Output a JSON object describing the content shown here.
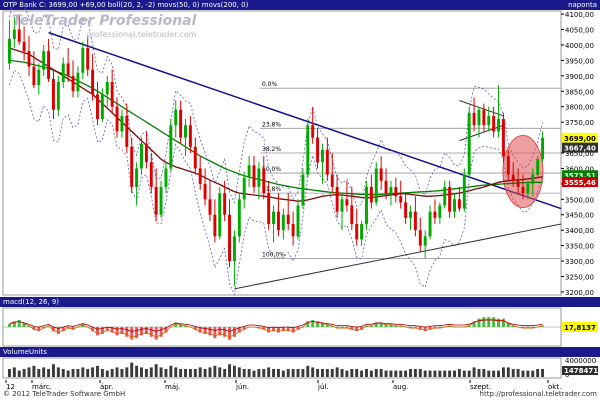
{
  "header": {
    "title": "OTP Bank",
    "info_text": "OTP Bank  C: 3699,00 +69,00  boll(20, 2, -2)  movs(50, 0)  movs(200, 0)",
    "period": "napontа",
    "watermark_line1": "TeleTrader Professional",
    "watermark_line2": "professional.teletrader.com"
  },
  "macd": {
    "label": "macd(12, 26, 9)",
    "value_label": "17,8137",
    "ticks": [
      "0"
    ]
  },
  "volume": {
    "label": "VolumeUnits",
    "ticks": [
      "4000000",
      "0"
    ],
    "value_label": "1478471"
  },
  "footer": {
    "copyright": "© 2012 TeleTrader Software GmbH",
    "url": "http://professional.teletrader.com"
  },
  "colors": {
    "up": "#00aa00",
    "down": "#dd0000",
    "trend": "#10108a",
    "sma50": "#7a0a0a",
    "sma200": "#008000",
    "boll": "#6060b0",
    "fib": "#999999",
    "highlight": "#e05050"
  },
  "chart_data": {
    "type": "candlestick",
    "title": "OTP Bank",
    "x_tick_labels": [
      "12",
      "márc.",
      "ápr.",
      "máj.",
      "jún.",
      "júl.",
      "aug.",
      "szept.",
      "okt."
    ],
    "y_tick_labels": [
      "4100,00",
      "4050,00",
      "4000,00",
      "3950,00",
      "3900,00",
      "3850,00",
      "3800,00",
      "3750,00",
      "3650,00",
      "3600,00",
      "3550,00",
      "3500,00",
      "3450,00",
      "3400,00",
      "3350,00",
      "3300,00",
      "3250,00",
      "3200,00"
    ],
    "y_ticks": [
      4100,
      4050,
      4000,
      3950,
      3900,
      3850,
      3800,
      3750,
      3650,
      3600,
      3550,
      3500,
      3450,
      3400,
      3350,
      3300,
      3250,
      3200
    ],
    "ylim": [
      3190,
      4110
    ],
    "last_price_label": "3699,00",
    "sma50_label": "3573,51",
    "sma200_label": "3555,46",
    "bb_label": "3667,40",
    "fib_levels": [
      {
        "label": "0,0%",
        "value": 3860
      },
      {
        "label": "23,8%",
        "value": 3730
      },
      {
        "label": "38,2%",
        "value": 3650
      },
      {
        "label": "50,0%",
        "value": 3585
      },
      {
        "label": "61,8%",
        "value": 3520
      },
      {
        "label": "100,0%",
        "value": 3308
      }
    ],
    "candles": [
      {
        "o": 3940,
        "h": 4080,
        "l": 3920,
        "c": 4020
      },
      {
        "o": 4020,
        "h": 4090,
        "l": 3990,
        "c": 4050
      },
      {
        "o": 4050,
        "h": 4100,
        "l": 4000,
        "c": 4010
      },
      {
        "o": 4010,
        "h": 4060,
        "l": 3950,
        "c": 3980
      },
      {
        "o": 3980,
        "h": 4030,
        "l": 3900,
        "c": 3930
      },
      {
        "o": 3930,
        "h": 3980,
        "l": 3860,
        "c": 3870
      },
      {
        "o": 3870,
        "h": 3940,
        "l": 3840,
        "c": 3920
      },
      {
        "o": 3920,
        "h": 4000,
        "l": 3900,
        "c": 3980
      },
      {
        "o": 3980,
        "h": 4020,
        "l": 3880,
        "c": 3890
      },
      {
        "o": 3890,
        "h": 3920,
        "l": 3760,
        "c": 3790
      },
      {
        "o": 3790,
        "h": 3900,
        "l": 3770,
        "c": 3880
      },
      {
        "o": 3880,
        "h": 3960,
        "l": 3860,
        "c": 3940
      },
      {
        "o": 3940,
        "h": 3990,
        "l": 3880,
        "c": 3900
      },
      {
        "o": 3900,
        "h": 3950,
        "l": 3830,
        "c": 3850
      },
      {
        "o": 3850,
        "h": 3930,
        "l": 3830,
        "c": 3910
      },
      {
        "o": 3910,
        "h": 4010,
        "l": 3890,
        "c": 3990
      },
      {
        "o": 3990,
        "h": 4030,
        "l": 3900,
        "c": 3920
      },
      {
        "o": 3920,
        "h": 3970,
        "l": 3820,
        "c": 3840
      },
      {
        "o": 3840,
        "h": 3880,
        "l": 3740,
        "c": 3760
      },
      {
        "o": 3760,
        "h": 3860,
        "l": 3750,
        "c": 3840
      },
      {
        "o": 3840,
        "h": 3900,
        "l": 3800,
        "c": 3880
      },
      {
        "o": 3880,
        "h": 3920,
        "l": 3780,
        "c": 3800
      },
      {
        "o": 3800,
        "h": 3830,
        "l": 3700,
        "c": 3720
      },
      {
        "o": 3720,
        "h": 3790,
        "l": 3700,
        "c": 3770
      },
      {
        "o": 3770,
        "h": 3810,
        "l": 3650,
        "c": 3670
      },
      {
        "o": 3670,
        "h": 3700,
        "l": 3520,
        "c": 3540
      },
      {
        "o": 3540,
        "h": 3620,
        "l": 3480,
        "c": 3600
      },
      {
        "o": 3600,
        "h": 3700,
        "l": 3580,
        "c": 3680
      },
      {
        "o": 3680,
        "h": 3720,
        "l": 3600,
        "c": 3620
      },
      {
        "o": 3620,
        "h": 3650,
        "l": 3520,
        "c": 3540
      },
      {
        "o": 3540,
        "h": 3600,
        "l": 3430,
        "c": 3450
      },
      {
        "o": 3450,
        "h": 3560,
        "l": 3440,
        "c": 3540
      },
      {
        "o": 3540,
        "h": 3620,
        "l": 3520,
        "c": 3600
      },
      {
        "o": 3600,
        "h": 3760,
        "l": 3590,
        "c": 3740
      },
      {
        "o": 3740,
        "h": 3820,
        "l": 3700,
        "c": 3790
      },
      {
        "o": 3790,
        "h": 3820,
        "l": 3680,
        "c": 3700
      },
      {
        "o": 3700,
        "h": 3760,
        "l": 3640,
        "c": 3740
      },
      {
        "o": 3740,
        "h": 3770,
        "l": 3650,
        "c": 3670
      },
      {
        "o": 3670,
        "h": 3700,
        "l": 3580,
        "c": 3600
      },
      {
        "o": 3600,
        "h": 3640,
        "l": 3530,
        "c": 3550
      },
      {
        "o": 3550,
        "h": 3600,
        "l": 3480,
        "c": 3500
      },
      {
        "o": 3500,
        "h": 3560,
        "l": 3430,
        "c": 3450
      },
      {
        "o": 3450,
        "h": 3500,
        "l": 3360,
        "c": 3380
      },
      {
        "o": 3380,
        "h": 3540,
        "l": 3370,
        "c": 3520
      },
      {
        "o": 3520,
        "h": 3560,
        "l": 3430,
        "c": 3450
      },
      {
        "o": 3450,
        "h": 3500,
        "l": 3280,
        "c": 3300
      },
      {
        "o": 3300,
        "h": 3400,
        "l": 3220,
        "c": 3380
      },
      {
        "o": 3380,
        "h": 3520,
        "l": 3360,
        "c": 3500
      },
      {
        "o": 3500,
        "h": 3590,
        "l": 3470,
        "c": 3570
      },
      {
        "o": 3570,
        "h": 3640,
        "l": 3540,
        "c": 3610
      },
      {
        "o": 3610,
        "h": 3640,
        "l": 3520,
        "c": 3540
      },
      {
        "o": 3540,
        "h": 3620,
        "l": 3500,
        "c": 3600
      },
      {
        "o": 3600,
        "h": 3640,
        "l": 3500,
        "c": 3520
      },
      {
        "o": 3520,
        "h": 3560,
        "l": 3400,
        "c": 3420
      },
      {
        "o": 3420,
        "h": 3480,
        "l": 3360,
        "c": 3460
      },
      {
        "o": 3460,
        "h": 3520,
        "l": 3380,
        "c": 3400
      },
      {
        "o": 3400,
        "h": 3470,
        "l": 3370,
        "c": 3450
      },
      {
        "o": 3450,
        "h": 3520,
        "l": 3400,
        "c": 3420
      },
      {
        "o": 3420,
        "h": 3460,
        "l": 3350,
        "c": 3380
      },
      {
        "o": 3380,
        "h": 3500,
        "l": 3370,
        "c": 3480
      },
      {
        "o": 3480,
        "h": 3600,
        "l": 3470,
        "c": 3580
      },
      {
        "o": 3580,
        "h": 3760,
        "l": 3570,
        "c": 3740
      },
      {
        "o": 3740,
        "h": 3800,
        "l": 3680,
        "c": 3700
      },
      {
        "o": 3700,
        "h": 3730,
        "l": 3600,
        "c": 3620
      },
      {
        "o": 3620,
        "h": 3680,
        "l": 3550,
        "c": 3660
      },
      {
        "o": 3660,
        "h": 3700,
        "l": 3560,
        "c": 3580
      },
      {
        "o": 3580,
        "h": 3650,
        "l": 3520,
        "c": 3540
      },
      {
        "o": 3540,
        "h": 3580,
        "l": 3440,
        "c": 3460
      },
      {
        "o": 3460,
        "h": 3520,
        "l": 3400,
        "c": 3500
      },
      {
        "o": 3500,
        "h": 3560,
        "l": 3460,
        "c": 3480
      },
      {
        "o": 3480,
        "h": 3540,
        "l": 3400,
        "c": 3420
      },
      {
        "o": 3420,
        "h": 3470,
        "l": 3350,
        "c": 3370
      },
      {
        "o": 3370,
        "h": 3430,
        "l": 3350,
        "c": 3420
      },
      {
        "o": 3420,
        "h": 3560,
        "l": 3400,
        "c": 3540
      },
      {
        "o": 3540,
        "h": 3580,
        "l": 3470,
        "c": 3490
      },
      {
        "o": 3490,
        "h": 3620,
        "l": 3480,
        "c": 3600
      },
      {
        "o": 3600,
        "h": 3640,
        "l": 3530,
        "c": 3560
      },
      {
        "o": 3560,
        "h": 3600,
        "l": 3500,
        "c": 3520
      },
      {
        "o": 3520,
        "h": 3560,
        "l": 3480,
        "c": 3540
      },
      {
        "o": 3540,
        "h": 3570,
        "l": 3490,
        "c": 3510
      },
      {
        "o": 3510,
        "h": 3560,
        "l": 3470,
        "c": 3490
      },
      {
        "o": 3490,
        "h": 3520,
        "l": 3420,
        "c": 3440
      },
      {
        "o": 3440,
        "h": 3480,
        "l": 3400,
        "c": 3460
      },
      {
        "o": 3460,
        "h": 3510,
        "l": 3380,
        "c": 3400
      },
      {
        "o": 3400,
        "h": 3440,
        "l": 3330,
        "c": 3350
      },
      {
        "o": 3350,
        "h": 3400,
        "l": 3310,
        "c": 3380
      },
      {
        "o": 3380,
        "h": 3480,
        "l": 3370,
        "c": 3460
      },
      {
        "o": 3460,
        "h": 3500,
        "l": 3420,
        "c": 3440
      },
      {
        "o": 3440,
        "h": 3490,
        "l": 3420,
        "c": 3480
      },
      {
        "o": 3480,
        "h": 3560,
        "l": 3470,
        "c": 3540
      },
      {
        "o": 3540,
        "h": 3560,
        "l": 3440,
        "c": 3460
      },
      {
        "o": 3460,
        "h": 3520,
        "l": 3440,
        "c": 3500
      },
      {
        "o": 3500,
        "h": 3540,
        "l": 3460,
        "c": 3470
      },
      {
        "o": 3470,
        "h": 3600,
        "l": 3460,
        "c": 3580
      },
      {
        "o": 3580,
        "h": 3800,
        "l": 3570,
        "c": 3780
      },
      {
        "o": 3780,
        "h": 3830,
        "l": 3720,
        "c": 3740
      },
      {
        "o": 3740,
        "h": 3800,
        "l": 3700,
        "c": 3790
      },
      {
        "o": 3790,
        "h": 3810,
        "l": 3720,
        "c": 3740
      },
      {
        "o": 3740,
        "h": 3800,
        "l": 3720,
        "c": 3770
      },
      {
        "o": 3770,
        "h": 3800,
        "l": 3700,
        "c": 3720
      },
      {
        "o": 3720,
        "h": 3870,
        "l": 3700,
        "c": 3760
      },
      {
        "o": 3760,
        "h": 3780,
        "l": 3620,
        "c": 3640
      },
      {
        "o": 3640,
        "h": 3660,
        "l": 3560,
        "c": 3580
      },
      {
        "o": 3580,
        "h": 3620,
        "l": 3540,
        "c": 3560
      },
      {
        "o": 3560,
        "h": 3600,
        "l": 3520,
        "c": 3540
      },
      {
        "o": 3540,
        "h": 3580,
        "l": 3500,
        "c": 3520
      },
      {
        "o": 3520,
        "h": 3560,
        "l": 3500,
        "c": 3550
      },
      {
        "o": 3550,
        "h": 3600,
        "l": 3510,
        "c": 3580
      },
      {
        "o": 3580,
        "h": 3640,
        "l": 3570,
        "c": 3630
      },
      {
        "o": 3630,
        "h": 3720,
        "l": 3620,
        "c": 3699
      }
    ],
    "sma50": [
      3990,
      3985,
      3980,
      3975,
      3970,
      3960,
      3950,
      3940,
      3930,
      3920,
      3910,
      3900,
      3890,
      3880,
      3870,
      3860,
      3850,
      3840,
      3825,
      3810,
      3795,
      3780,
      3765,
      3750,
      3735,
      3720,
      3705,
      3690,
      3675,
      3660,
      3645,
      3630,
      3620,
      3612,
      3605,
      3600,
      3595,
      3590,
      3585,
      3578,
      3570,
      3562,
      3555,
      3548,
      3540,
      3532,
      3525,
      3520,
      3518,
      3516,
      3514,
      3512,
      3510,
      3508,
      3505,
      3502,
      3500,
      3498,
      3496,
      3494,
      3495,
      3498,
      3502,
      3506,
      3510,
      3512,
      3514,
      3515,
      3514,
      3512,
      3510,
      3508,
      3506,
      3505,
      3506,
      3508,
      3510,
      3512,
      3514,
      3516,
      3518,
      3518,
      3516,
      3514,
      3512,
      3510,
      3510,
      3511,
      3512,
      3514,
      3516,
      3518,
      3520,
      3524,
      3528,
      3532,
      3536,
      3540,
      3545,
      3550,
      3555,
      3558,
      3560,
      3562,
      3563,
      3564,
      3566,
      3568,
      3570,
      3573
    ],
    "sma200": [
      3950,
      3948,
      3946,
      3944,
      3940,
      3936,
      3932,
      3928,
      3924,
      3918,
      3912,
      3906,
      3900,
      3892,
      3884,
      3876,
      3868,
      3860,
      3850,
      3840,
      3830,
      3820,
      3810,
      3800,
      3790,
      3780,
      3770,
      3760,
      3750,
      3740,
      3730,
      3720,
      3710,
      3700,
      3690,
      3680,
      3670,
      3660,
      3650,
      3640,
      3632,
      3624,
      3616,
      3608,
      3600,
      3594,
      3588,
      3582,
      3576,
      3572,
      3568,
      3564,
      3560,
      3556,
      3552,
      3548,
      3545,
      3542,
      3539,
      3536,
      3534,
      3532,
      3530,
      3528,
      3526,
      3524,
      3522,
      3521,
      3520,
      3519,
      3518,
      3517,
      3516,
      3515,
      3515,
      3515,
      3516,
      3517,
      3518,
      3519,
      3520,
      3521,
      3522,
      3523,
      3524,
      3525,
      3526,
      3527,
      3528,
      3530,
      3532,
      3534,
      3536,
      3538,
      3540,
      3542,
      3544,
      3546,
      3547,
      3548,
      3549,
      3550,
      3551,
      3552,
      3553,
      3554,
      3554,
      3555,
      3555,
      3555
    ],
    "macd_hist": [
      0.2,
      0.4,
      0.5,
      0.3,
      0.1,
      -0.2,
      -0.3,
      -0.1,
      0.1,
      -0.3,
      -0.5,
      -0.3,
      -0.1,
      -0.2,
      0,
      0.2,
      0,
      -0.3,
      -0.6,
      -0.5,
      -0.3,
      -0.4,
      -0.6,
      -0.5,
      -0.7,
      -0.9,
      -0.8,
      -0.6,
      -0.5,
      -0.7,
      -0.9,
      -0.7,
      -0.4,
      0,
      0.3,
      0.2,
      0.1,
      0,
      -0.2,
      -0.4,
      -0.5,
      -0.6,
      -0.8,
      -0.6,
      -0.7,
      -0.9,
      -0.7,
      -0.4,
      -0.2,
      0,
      0,
      -0.1,
      -0.2,
      -0.4,
      -0.3,
      -0.4,
      -0.3,
      -0.3,
      -0.4,
      -0.2,
      0,
      0.4,
      0.5,
      0.4,
      0.3,
      0.2,
      0.1,
      -0.1,
      -0.1,
      -0.1,
      -0.2,
      -0.3,
      -0.2,
      0.1,
      0.1,
      0.3,
      0.3,
      0.2,
      0.2,
      0.1,
      0.1,
      0,
      -0.1,
      -0.1,
      -0.2,
      -0.3,
      -0.2,
      -0.1,
      -0.1,
      0,
      0.1,
      0,
      0,
      0,
      0.1,
      0.4,
      0.6,
      0.7,
      0.7,
      0.7,
      0.6,
      0.6,
      0.3,
      0.1,
      0,
      -0.1,
      -0.1,
      -0.1,
      0,
      0.1
    ],
    "volume": [
      0.5,
      0.6,
      0.4,
      0.5,
      0.6,
      0.7,
      0.5,
      0.6,
      0.5,
      0.8,
      0.6,
      0.5,
      0.4,
      0.5,
      0.5,
      0.6,
      0.5,
      0.6,
      0.7,
      0.5,
      0.4,
      0.5,
      0.6,
      0.5,
      0.6,
      0.9,
      0.7,
      0.6,
      0.5,
      0.6,
      0.8,
      0.6,
      0.5,
      0.7,
      0.6,
      0.5,
      0.5,
      0.5,
      0.5,
      0.6,
      0.5,
      0.6,
      0.7,
      0.6,
      0.5,
      0.8,
      0.7,
      0.6,
      0.5,
      0.5,
      0.4,
      0.5,
      0.5,
      0.6,
      0.5,
      0.5,
      0.4,
      0.5,
      0.5,
      0.5,
      0.5,
      0.7,
      0.6,
      0.5,
      0.5,
      0.5,
      0.5,
      0.6,
      0.5,
      0.4,
      0.5,
      0.5,
      0.4,
      0.5,
      0.4,
      0.5,
      0.5,
      0.4,
      0.4,
      0.4,
      0.4,
      0.4,
      0.5,
      0.5,
      0.5,
      0.4,
      0.4,
      0.4,
      0.4,
      0.4,
      0.4,
      0.4,
      0.5,
      0.4,
      0.4,
      0.6,
      0.5,
      0.5,
      0.4,
      0.4,
      0.4,
      0.6,
      0.6,
      0.5,
      0.5,
      0.4,
      0.4,
      0.4,
      0.5,
      0.5
    ]
  }
}
